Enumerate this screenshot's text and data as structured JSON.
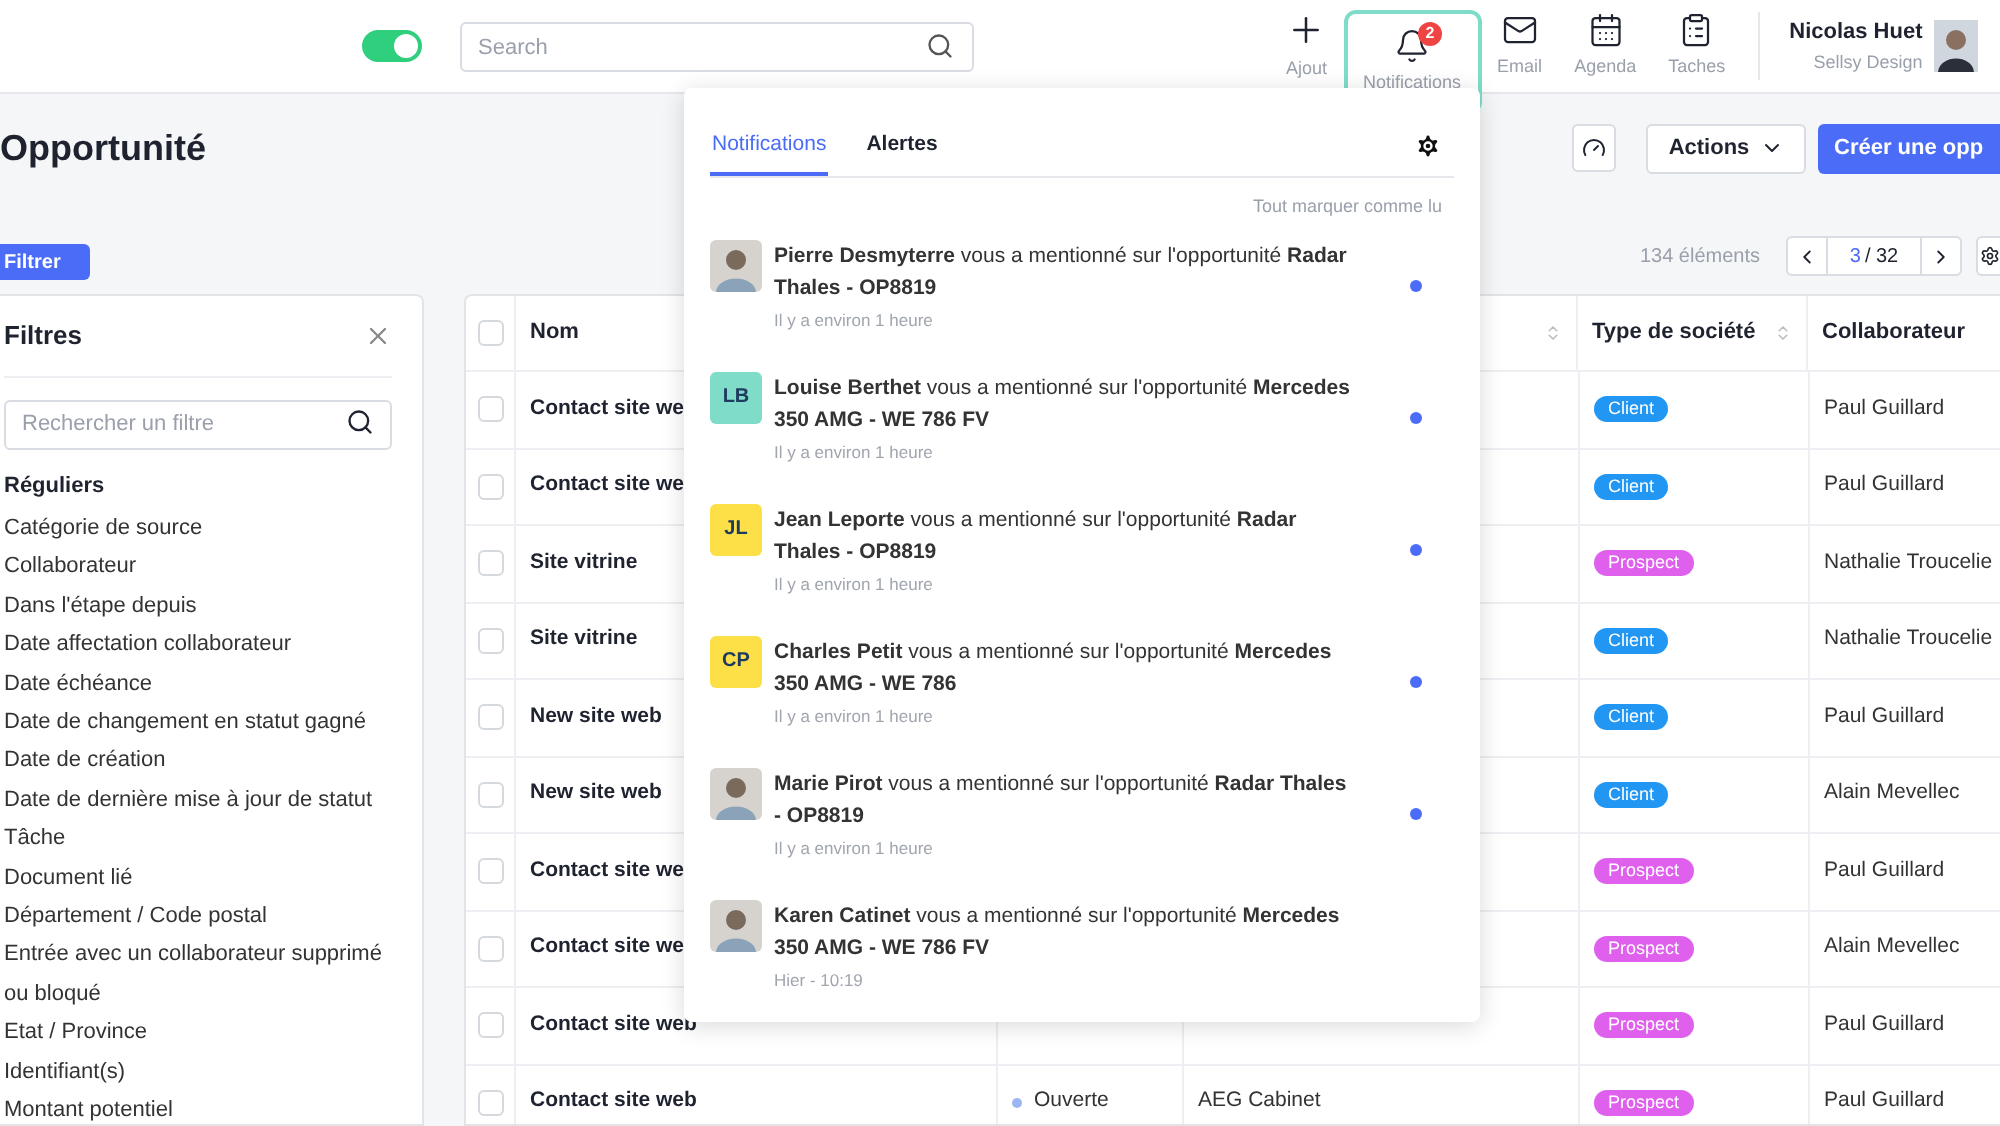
{
  "topbar": {
    "toggle": {
      "on": true
    },
    "search": {
      "placeholder": "Search"
    },
    "nav": [
      {
        "kind": "add",
        "label": "Ajout",
        "selected": false
      },
      {
        "kind": "bell",
        "label": "Notifications",
        "selected": true,
        "badge": "2"
      },
      {
        "kind": "mail",
        "label": "Email",
        "selected": false
      },
      {
        "kind": "calendar",
        "label": "Agenda",
        "selected": false
      },
      {
        "kind": "tasks",
        "label": "Taches",
        "selected": false
      }
    ],
    "user": {
      "name": "Nicolas Huet",
      "company": "Sellsy Design"
    }
  },
  "page": {
    "title": "Opportunité",
    "filter_button": "Filtrer",
    "actions_button": "Actions",
    "create_button": "Créer une opp",
    "count": "134 éléments",
    "page_current": "3",
    "page_total": "/ 32"
  },
  "filters": {
    "title": "Filtres",
    "search": {
      "placeholder": "Rechercher un filtre"
    },
    "section": "Réguliers",
    "items": [
      "Catégorie de source",
      "Collaborateur",
      "Dans l'étape depuis",
      "Date affectation collaborateur",
      "Date échéance",
      "Date de changement en statut gagné",
      "Date de création",
      "Date de dernière mise à jour de statut",
      "Tâche",
      "Document lié",
      "Département / Code postal",
      "Entrée avec un collaborateur supprimé ou bloqué",
      "Etat / Province",
      "Identifiant(s)",
      "Montant potentiel"
    ]
  },
  "table": {
    "select_all_checked": false,
    "columns": [
      {
        "label": "Nom"
      },
      {},
      {
        "sortable": true
      },
      {
        "label": "Type de société",
        "sortable": true
      },
      {
        "label": "Collaborateur"
      }
    ],
    "rows": [
      {
        "checked": false,
        "name": "Contact site we",
        "type": {
          "label": "Client",
          "color": "#2196f3"
        },
        "collaborator": "Paul Guillard"
      },
      {
        "checked": false,
        "name": "Contact site we",
        "type": {
          "label": "Client",
          "color": "#2196f3"
        },
        "collaborator": "Paul Guillard"
      },
      {
        "checked": false,
        "name": "Site vitrine",
        "type": {
          "label": "Prospect",
          "color": "#e060ee"
        },
        "collaborator": "Nathalie Troucelie"
      },
      {
        "checked": false,
        "name": "Site vitrine",
        "type": {
          "label": "Client",
          "color": "#2196f3"
        },
        "collaborator": "Nathalie Troucelie"
      },
      {
        "checked": false,
        "name": "New site web",
        "type": {
          "label": "Client",
          "color": "#2196f3"
        },
        "collaborator": "Paul Guillard"
      },
      {
        "checked": false,
        "name": "New site web",
        "type": {
          "label": "Client",
          "color": "#2196f3"
        },
        "collaborator": "Alain Mevellec"
      },
      {
        "checked": false,
        "name": "Contact site we",
        "type": {
          "label": "Prospect",
          "color": "#e060ee"
        },
        "collaborator": "Paul Guillard"
      },
      {
        "checked": false,
        "name": "Contact site we",
        "type": {
          "label": "Prospect",
          "color": "#e060ee"
        },
        "collaborator": "Alain Mevellec"
      },
      {
        "checked": false,
        "name": "Contact site web",
        "type": {
          "label": "Prospect",
          "color": "#e060ee"
        },
        "collaborator": "Paul Guillard"
      },
      {
        "checked": false,
        "name": "Contact site web",
        "status": {
          "label": "Ouverte",
          "color": "#9bb8f5"
        },
        "company": "AEG Cabinet",
        "type": {
          "label": "Prospect",
          "color": "#e060ee"
        },
        "collaborator": "Paul Guillard"
      }
    ]
  },
  "notifications": {
    "tabs": [
      {
        "label": "Notifications",
        "selected": true
      },
      {
        "label": "Alertes",
        "selected": false
      }
    ],
    "mark_all": "Tout marquer comme lu",
    "items": [
      {
        "text": "**Pierre Desmyterre** vous a mentionné sur l'opportunité **Radar Thales - OP8819**",
        "time": "Il y a environ 1 heure",
        "unread": true
      },
      {
        "avatar": {
          "kind": "initials",
          "initials": "LB",
          "color": "#7edcc8"
        },
        "text": "**Louise Berthet** vous a mentionné sur l'opportunité **Mercedes 350 AMG - WE 786 FV**",
        "time": "Il y a environ 1 heure",
        "unread": true
      },
      {
        "avatar": {
          "kind": "initials",
          "initials": "JL",
          "color": "#fde047"
        },
        "text": "**Jean Leporte** vous a mentionné sur l'opportunité **Radar Thales - OP8819**",
        "time": "Il y a environ 1 heure",
        "unread": true
      },
      {
        "avatar": {
          "kind": "initials",
          "initials": "CP",
          "color": "#fde047"
        },
        "text": "**Charles Petit** vous a mentionné sur l'opportunité **Mercedes 350 AMG - WE 786**",
        "time": "Il y a environ 1 heure",
        "unread": true
      },
      {
        "text": "**Marie Pirot** vous a mentionné sur l'opportunité **Radar Thales - OP8819**",
        "time": "Il y a environ 1 heure",
        "unread": true
      },
      {
        "text": "**Karen Catinet** vous a mentionné sur l'opportunité **Mercedes 350 AMG - WE 786 FV**",
        "time": "Hier - 10:19",
        "unread": false
      }
    ]
  }
}
